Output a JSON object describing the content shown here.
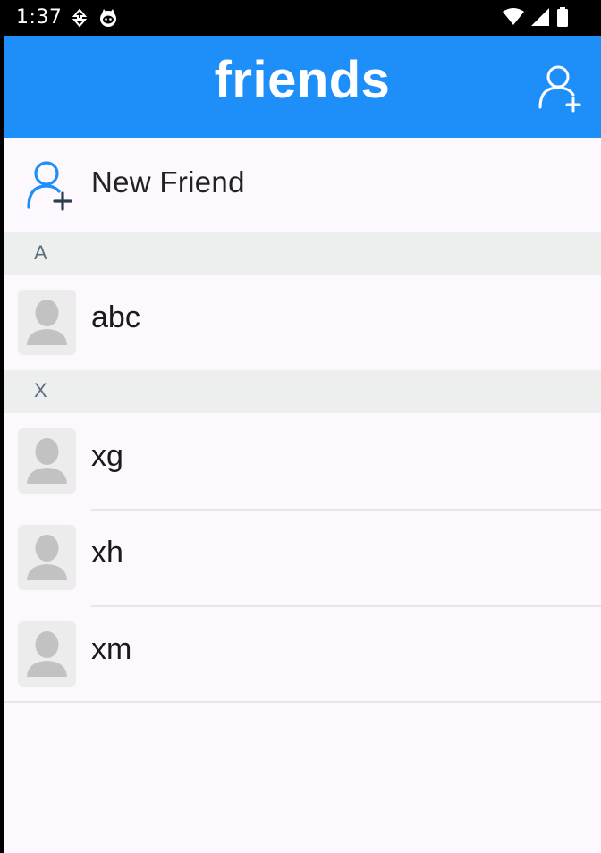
{
  "status_bar": {
    "time": "1:37",
    "left_icons": [
      "navigation-arrow-icon",
      "cat-face-icon"
    ],
    "right_icons": [
      "wifi-icon",
      "cell-signal-icon",
      "battery-icon"
    ]
  },
  "app_bar": {
    "title": "friends",
    "add_friend_icon": "add-person-icon",
    "bg_color": "#1e8ff9"
  },
  "new_friend": {
    "label": "New Friend",
    "icon": "add-person-icon"
  },
  "sections": [
    {
      "letter": "A",
      "contacts": [
        {
          "name": "abc"
        }
      ]
    },
    {
      "letter": "X",
      "contacts": [
        {
          "name": "xg"
        },
        {
          "name": "xh"
        },
        {
          "name": "xm"
        }
      ]
    }
  ]
}
